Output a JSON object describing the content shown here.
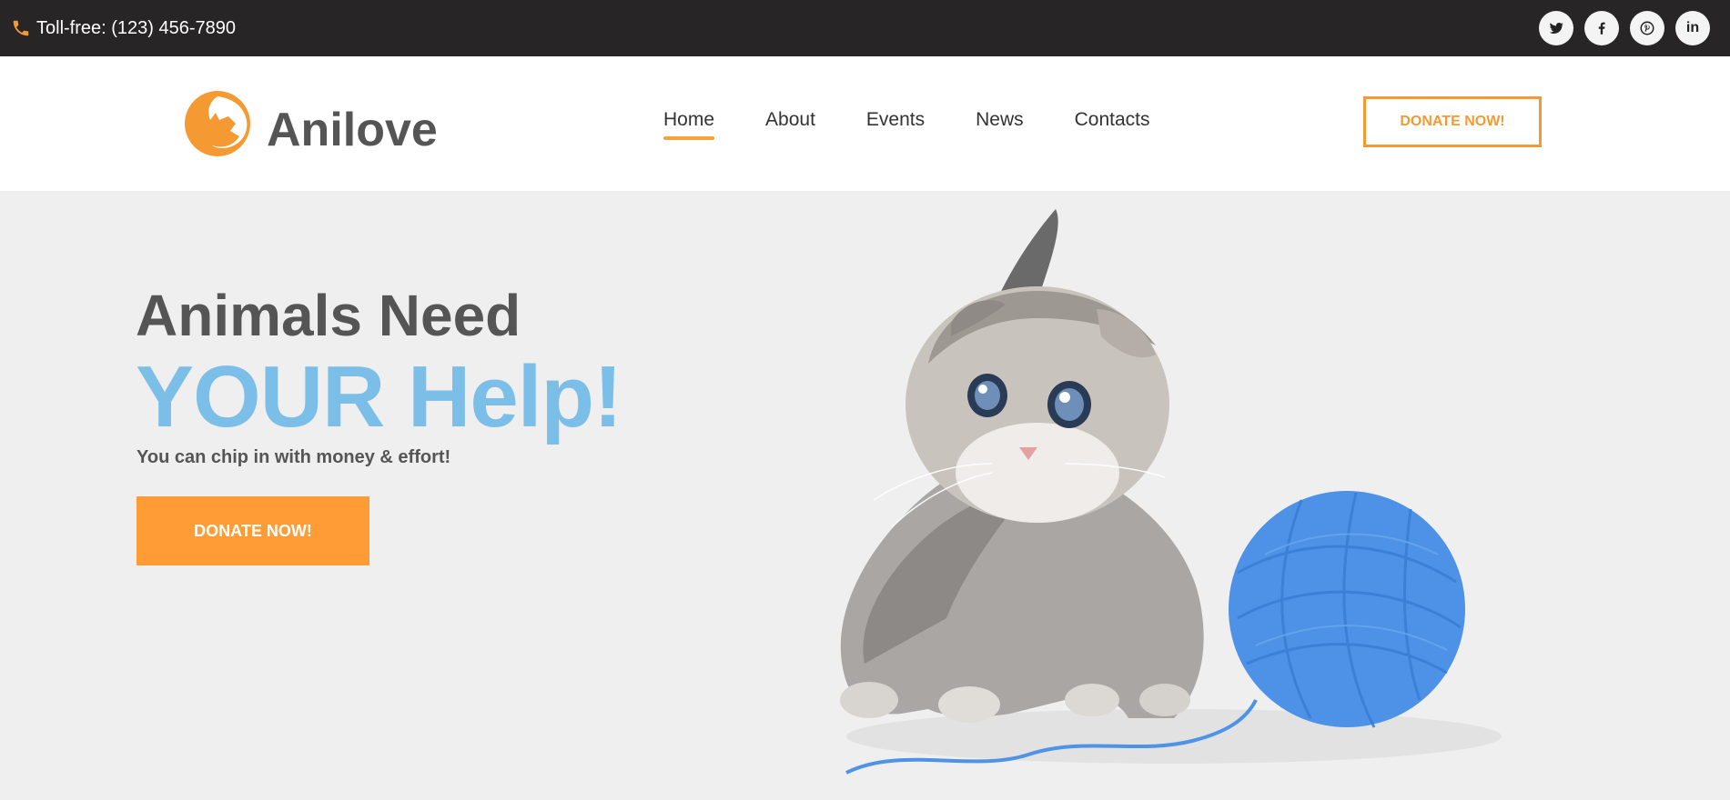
{
  "topbar": {
    "phone_text": "Toll-free: (123) 456-7890",
    "socials": [
      {
        "name": "twitter-icon"
      },
      {
        "name": "facebook-icon"
      },
      {
        "name": "pinterest-icon"
      },
      {
        "name": "linkedin-icon"
      }
    ]
  },
  "header": {
    "logo_text": "Anilove",
    "nav": [
      "Home",
      "About",
      "Events",
      "News",
      "Contacts"
    ],
    "active_nav": "Home",
    "donate_label": "DONATE NOW!"
  },
  "hero": {
    "line1": "Animals Need",
    "line2": "YOUR Help!",
    "subtitle": "You can chip in with money & effort!",
    "donate_label": "DONATE NOW!"
  },
  "colors": {
    "accent_orange": "#f59a33",
    "hero_blue": "#7bbfe9",
    "topbar_bg": "#272526",
    "text_gray": "#555555"
  }
}
